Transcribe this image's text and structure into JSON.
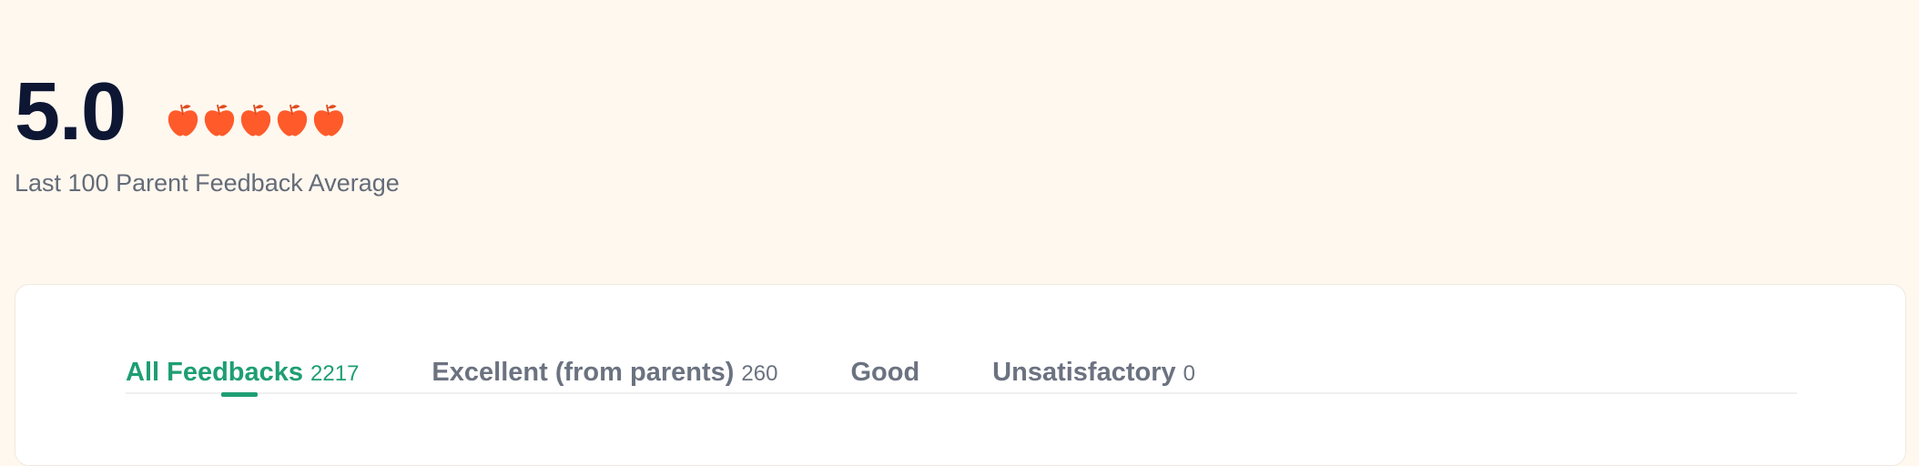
{
  "summary": {
    "score": "5.0",
    "rating": 5,
    "max_rating": 5,
    "subtitle": "Last 100 Parent Feedback Average"
  },
  "tabs": [
    {
      "label": "All Feedbacks",
      "count": "2217",
      "active": true
    },
    {
      "label": "Excellent (from parents)",
      "count": "260",
      "active": false
    },
    {
      "label": "Good",
      "count": "",
      "active": false
    },
    {
      "label": "Unsatisfactory",
      "count": "0",
      "active": false
    }
  ],
  "colors": {
    "background": "#FFF8EF",
    "score_text": "#0D1733",
    "apple": "#FF5A2A",
    "active_tab": "#1E9E73",
    "inactive_tab": "#6B7280"
  },
  "icons": {
    "rating": "apple-icon"
  }
}
